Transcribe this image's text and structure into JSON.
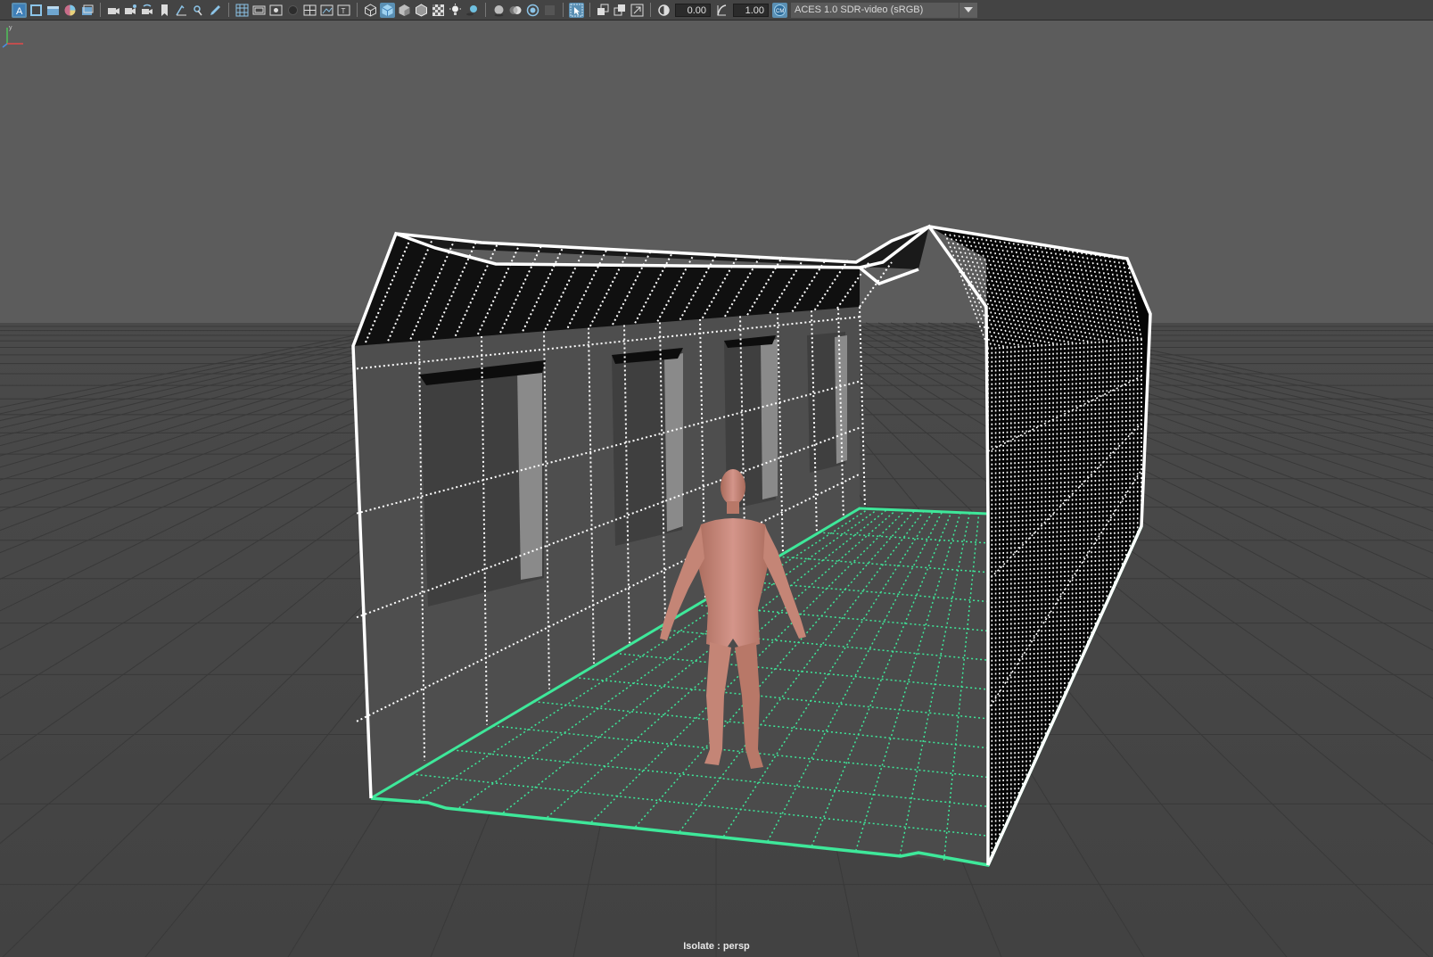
{
  "toolbar": {
    "icons_left": [
      "select-camera-icon",
      "camera-attributes-icon",
      "bookmarks-icon",
      "image-plane-icon",
      "2d-pan-zoom-icon",
      "grease-pencil-icon"
    ],
    "icons_camera": [
      "camera-tools-icon",
      "camera-sequence-icon",
      "camera-tumble-icon",
      "bookmark-icon",
      "snap-icon",
      "move-icon",
      "pencil-icon"
    ],
    "icons_view": [
      "grid-icon",
      "film-gate-icon",
      "resolution-gate-icon",
      "gate-mask-icon",
      "field-chart-icon",
      "safe-action-icon",
      "safe-title-icon"
    ],
    "icons_shading": [
      "wireframe-icon",
      "smooth-shade-icon",
      "shade-default-icon",
      "wireframe-on-shaded-icon",
      "xray-icon",
      "lights-icon",
      "shadows-icon",
      "ambient-occlusion-icon",
      "motion-blur-icon",
      "antialias-icon",
      "depth-icon"
    ],
    "icons_isolate": [
      "isolate-select-icon",
      "xray-joints-icon",
      "xray-active-icon",
      "image-plane-toggle-icon"
    ],
    "exposure_value": "0.00",
    "gamma_value": "1.00",
    "view_transform": "ACES 1.0 SDR-video (sRGB)"
  },
  "viewport": {
    "panel_label": "Isolate : persp",
    "colors": {
      "background_top": "#5d5d5d",
      "ground": "#454545",
      "grid_line": "#3a3a3a",
      "wire_selected": "#ffffff",
      "floor_highlight": "#3ee89a",
      "figure_skin": "#c98a78"
    }
  }
}
